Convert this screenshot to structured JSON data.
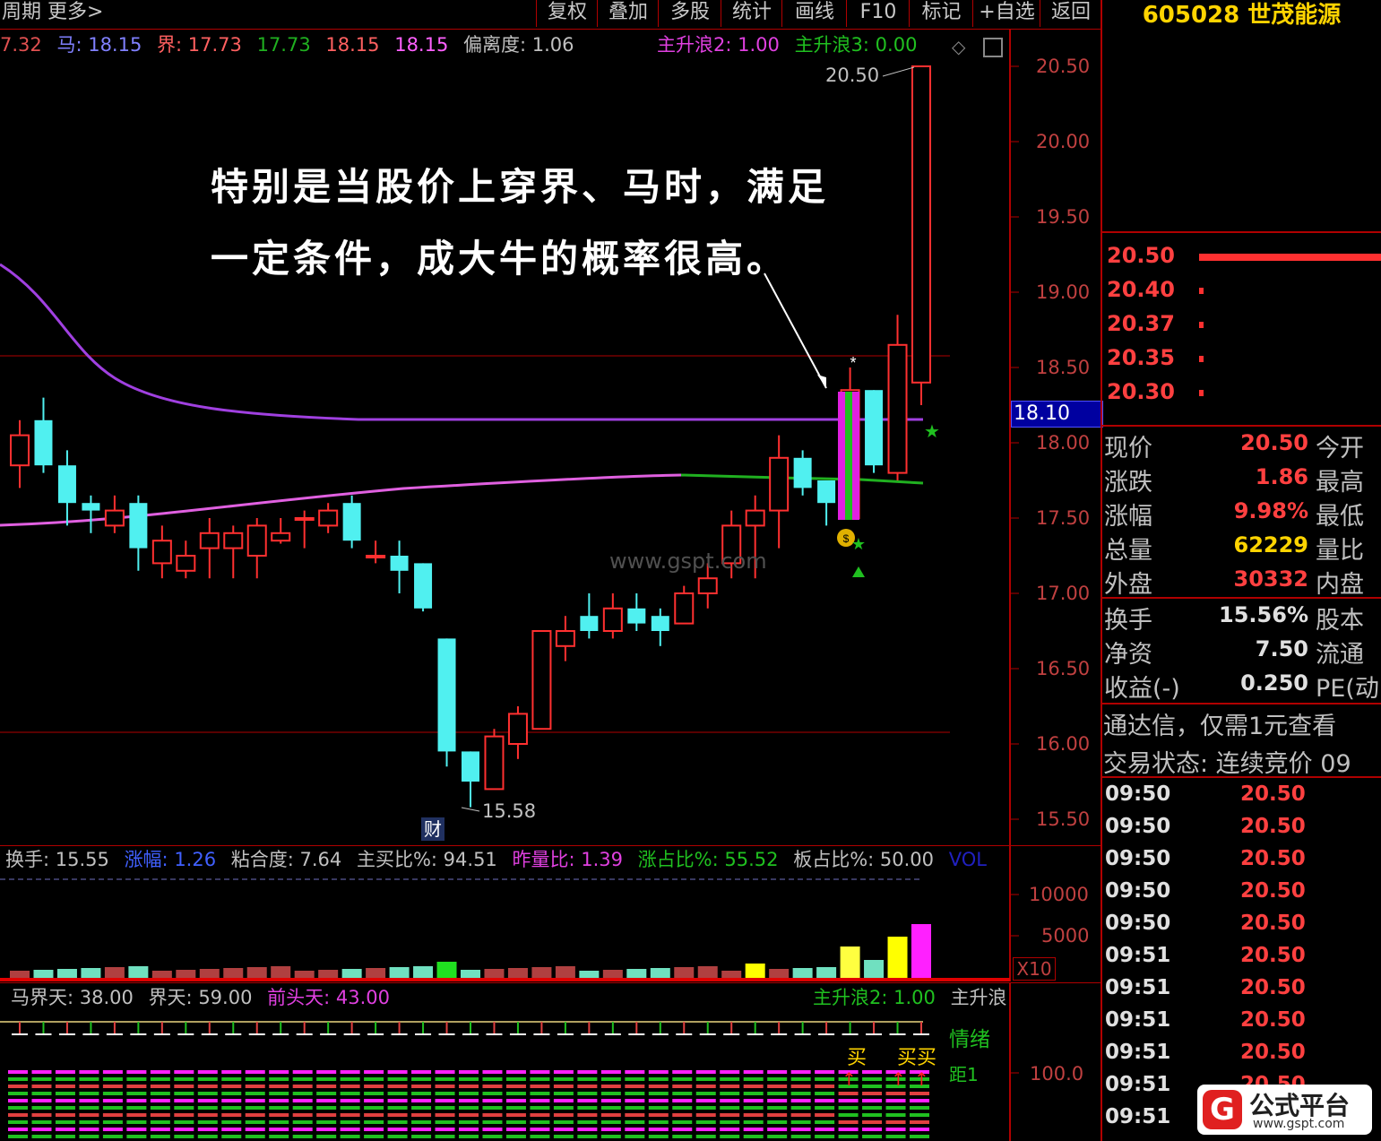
{
  "topbar": {
    "left_text": "周期  更多>",
    "buttons": [
      "复权",
      "叠加",
      "多股",
      "统计",
      "画线",
      "F10",
      "标记",
      "+自选",
      "返回"
    ]
  },
  "stock": {
    "code": "605028",
    "name": "世茂能源"
  },
  "main_indicator": {
    "prefix": "7.32",
    "ma_label": "马: 18.15",
    "jie_label": "界: 17.73",
    "v1": "17.73",
    "v2": "18.15",
    "v3": "18.15",
    "deviation": "偏离度: 1.06",
    "wave2": "主升浪2: 1.00",
    "wave3": "主升浪3: 0.00"
  },
  "price_axis": [
    "20.50",
    "20.00",
    "19.50",
    "19.00",
    "18.50",
    "18.00",
    "17.50",
    "17.00",
    "16.50",
    "16.00",
    "15.50"
  ],
  "current_price_tag": "18.10",
  "high_marker": "20.50",
  "low_marker": "15.58",
  "cai_label": "财",
  "watermark": "www.gspt.com",
  "annotation": {
    "line1": "特别是当股价上穿界、马时，满足",
    "line2": "一定条件，成大牛的概率很高。"
  },
  "volume_indicator": {
    "turnover": "换手: 15.55",
    "rise": "涨幅: 1.26",
    "stickiness": "粘合度: 7.64",
    "buy_ratio": "主买比%: 94.51",
    "yesterday_ratio": "昨量比: 1.39",
    "rise_share": "涨占比%: 55.52",
    "board_share": "板占比%: 50.00",
    "vol": "VOL"
  },
  "volume_axis": [
    "10000",
    "5000"
  ],
  "x10_label": "X10",
  "bottom_indicator": {
    "ma_days": "马界天: 38.00",
    "jie_days": "界天: 59.00",
    "front_days": "前头天: 43.00",
    "wave2": "主升浪2: 1.00",
    "wave_trunc": "主升浪",
    "emotion": "情绪",
    "ju": "距1",
    "buy1": "买",
    "buy2": "买买"
  },
  "bottom_axis": [
    "100.0"
  ],
  "order_book": [
    "20.50",
    "20.40",
    "20.37",
    "20.35",
    "20.30"
  ],
  "quote": [
    {
      "label": "现价",
      "value": "20.50",
      "label2": "今开",
      "color": "#ff4040"
    },
    {
      "label": "涨跌",
      "value": "1.86",
      "label2": "最高",
      "color": "#ff4040"
    },
    {
      "label": "涨幅",
      "value": "9.98%",
      "label2": "最低",
      "color": "#ff4040"
    },
    {
      "label": "总量",
      "value": "62229",
      "label2": "量比",
      "color": "#ffd400"
    },
    {
      "label": "外盘",
      "value": "30332",
      "label2": "内盘",
      "color": "#ff4040"
    }
  ],
  "quote2": [
    {
      "label": "换手",
      "value": "15.56%",
      "label2": "股本"
    },
    {
      "label": "净资",
      "value": "7.50",
      "label2": "流通"
    },
    {
      "label": "收益(-)",
      "value": "0.250",
      "label2": "PE(动"
    }
  ],
  "promo": "通达信，仅需1元查看",
  "trade_status": "交易状态: 连续竞价 09",
  "ticks": [
    {
      "time": "09:50",
      "price": "20.50"
    },
    {
      "time": "09:50",
      "price": "20.50"
    },
    {
      "time": "09:50",
      "price": "20.50"
    },
    {
      "time": "09:50",
      "price": "20.50"
    },
    {
      "time": "09:50",
      "price": "20.50"
    },
    {
      "time": "09:51",
      "price": "20.50"
    },
    {
      "time": "09:51",
      "price": "20.50"
    },
    {
      "time": "09:51",
      "price": "20.50"
    },
    {
      "time": "09:51",
      "price": "20.50"
    },
    {
      "time": "09:51",
      "price": "20.50"
    },
    {
      "time": "09:51",
      "price": "20.50"
    }
  ],
  "logo": {
    "name": "公式平台",
    "url": "www.gspt.com"
  },
  "chart_data": {
    "type": "candlestick",
    "ylim": [
      15.3,
      20.7
    ],
    "candles": [
      {
        "o": 17.85,
        "c": 18.05,
        "h": 18.15,
        "l": 17.7
      },
      {
        "o": 18.15,
        "c": 17.85,
        "h": 18.3,
        "l": 17.8
      },
      {
        "o": 17.85,
        "c": 17.6,
        "h": 17.95,
        "l": 17.45
      },
      {
        "o": 17.6,
        "c": 17.55,
        "h": 17.65,
        "l": 17.4
      },
      {
        "o": 17.45,
        "c": 17.55,
        "h": 17.65,
        "l": 17.4
      },
      {
        "o": 17.6,
        "c": 17.3,
        "h": 17.65,
        "l": 17.15
      },
      {
        "o": 17.2,
        "c": 17.35,
        "h": 17.45,
        "l": 17.1
      },
      {
        "o": 17.15,
        "c": 17.25,
        "h": 17.35,
        "l": 17.1
      },
      {
        "o": 17.3,
        "c": 17.4,
        "h": 17.5,
        "l": 17.1
      },
      {
        "o": 17.3,
        "c": 17.4,
        "h": 17.45,
        "l": 17.1
      },
      {
        "o": 17.25,
        "c": 17.45,
        "h": 17.5,
        "l": 17.1
      },
      {
        "o": 17.35,
        "c": 17.4,
        "h": 17.5,
        "l": 17.33
      },
      {
        "o": 17.5,
        "c": 17.5,
        "h": 17.55,
        "l": 17.3
      },
      {
        "o": 17.45,
        "c": 17.55,
        "h": 17.6,
        "l": 17.4
      },
      {
        "o": 17.6,
        "c": 17.35,
        "h": 17.65,
        "l": 17.3
      },
      {
        "o": 17.25,
        "c": 17.25,
        "h": 17.35,
        "l": 17.2
      },
      {
        "o": 17.25,
        "c": 17.15,
        "h": 17.35,
        "l": 17.0
      },
      {
        "o": 17.2,
        "c": 16.9,
        "h": 17.2,
        "l": 16.88
      },
      {
        "o": 16.7,
        "c": 15.95,
        "h": 16.7,
        "l": 15.85
      },
      {
        "o": 15.95,
        "c": 15.75,
        "h": 15.95,
        "l": 15.58
      },
      {
        "o": 15.7,
        "c": 16.05,
        "h": 16.1,
        "l": 15.7
      },
      {
        "o": 16.0,
        "c": 16.2,
        "h": 16.25,
        "l": 15.9
      },
      {
        "o": 16.1,
        "c": 16.75,
        "h": 16.75,
        "l": 16.1
      },
      {
        "o": 16.65,
        "c": 16.75,
        "h": 16.85,
        "l": 16.55
      },
      {
        "o": 16.85,
        "c": 16.75,
        "h": 17.0,
        "l": 16.7
      },
      {
        "o": 16.75,
        "c": 16.9,
        "h": 17.0,
        "l": 16.7
      },
      {
        "o": 16.9,
        "c": 16.8,
        "h": 17.0,
        "l": 16.75
      },
      {
        "o": 16.85,
        "c": 16.75,
        "h": 16.9,
        "l": 16.65
      },
      {
        "o": 16.8,
        "c": 17.0,
        "h": 17.05,
        "l": 16.8
      },
      {
        "o": 17.0,
        "c": 17.1,
        "h": 17.2,
        "l": 16.9
      },
      {
        "o": 17.2,
        "c": 17.45,
        "h": 17.55,
        "l": 17.1
      },
      {
        "o": 17.45,
        "c": 17.55,
        "h": 17.65,
        "l": 17.1
      },
      {
        "o": 17.55,
        "c": 17.9,
        "h": 18.05,
        "l": 17.3
      },
      {
        "o": 17.9,
        "c": 17.7,
        "h": 17.95,
        "l": 17.65
      },
      {
        "o": 17.75,
        "c": 17.6,
        "h": 17.75,
        "l": 17.45
      },
      {
        "o": 17.5,
        "c": 18.35,
        "h": 18.5,
        "l": 17.5
      },
      {
        "o": 18.35,
        "c": 17.85,
        "h": 18.35,
        "l": 17.8
      },
      {
        "o": 17.8,
        "c": 18.65,
        "h": 18.85,
        "l": 17.75
      },
      {
        "o": 18.4,
        "c": 20.5,
        "h": 20.5,
        "l": 18.25
      }
    ],
    "ma_purple": 18.1,
    "ma_green": 17.73
  }
}
